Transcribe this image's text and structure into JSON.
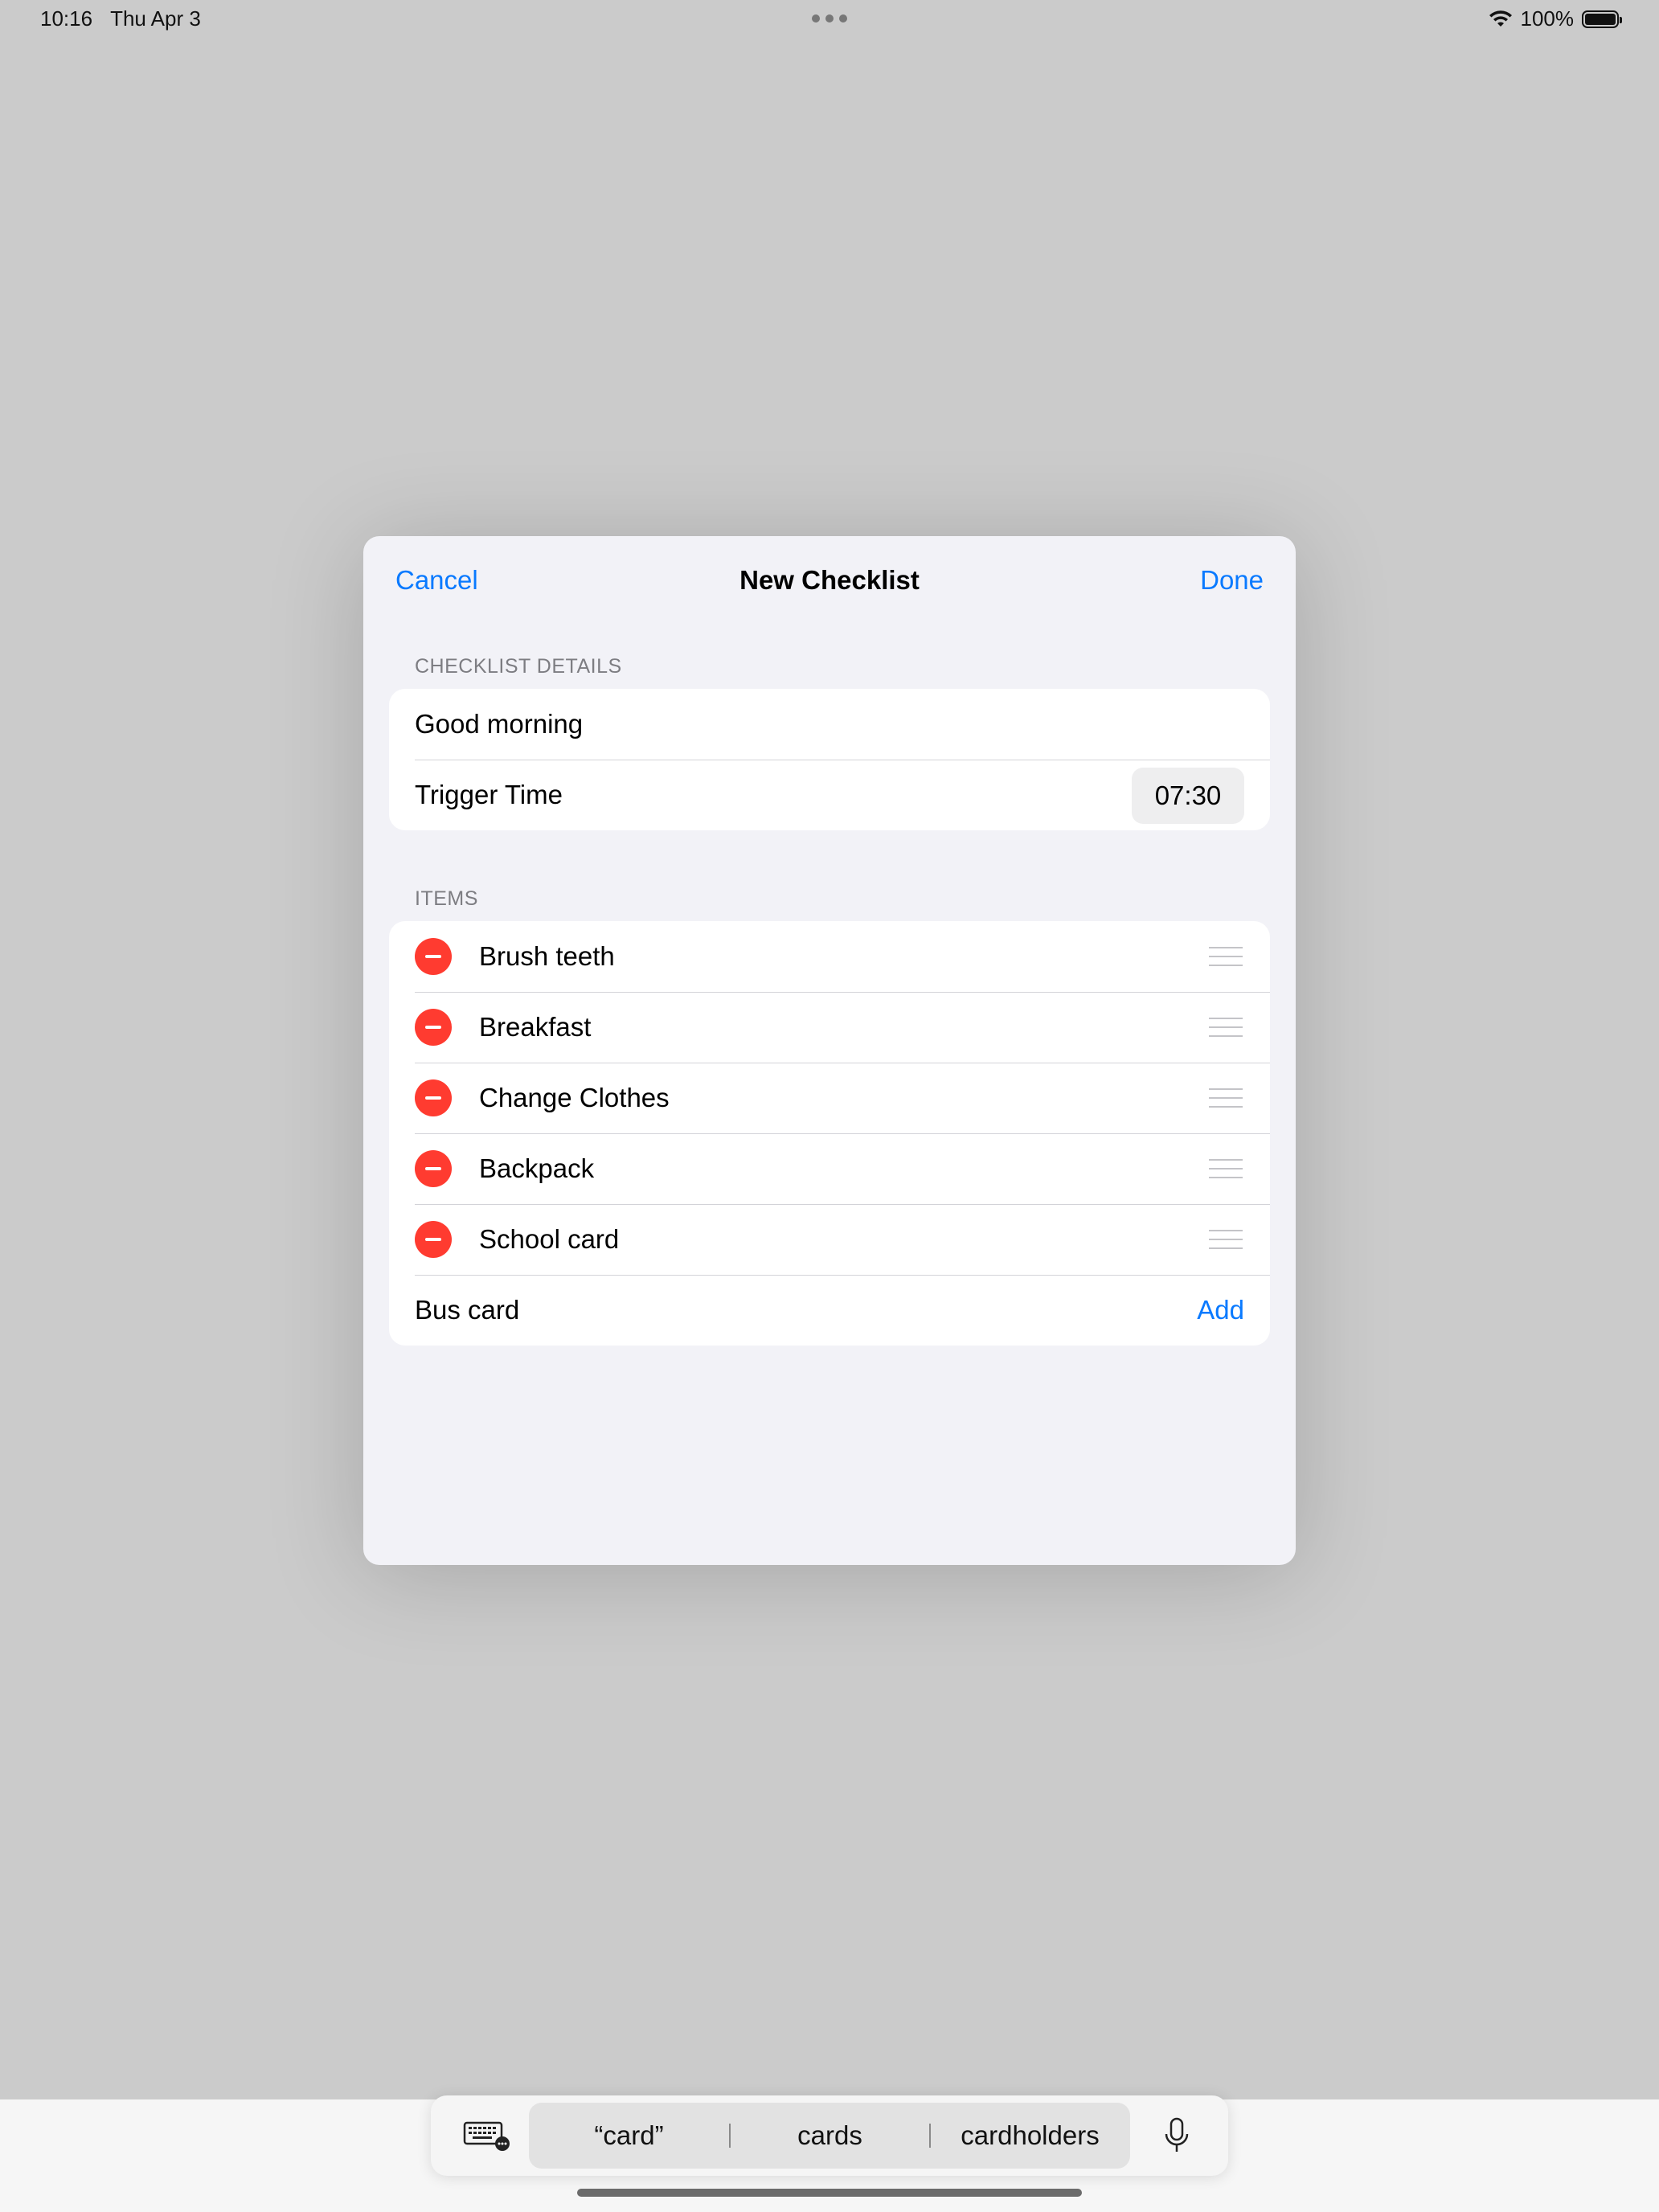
{
  "status_bar": {
    "time": "10:16",
    "date": "Thu Apr 3",
    "battery": "100%",
    "wifi_icon": "wifi-icon",
    "battery_icon": "battery-icon"
  },
  "nav": {
    "cancel": "Cancel",
    "title": "New Checklist",
    "done": "Done"
  },
  "details": {
    "header": "CHECKLIST DETAILS",
    "name_value": "Good morning",
    "trigger_label": "Trigger Time",
    "trigger_time": "07:30"
  },
  "items": {
    "header": "ITEMS",
    "list": [
      {
        "label": "Brush teeth"
      },
      {
        "label": "Breakfast"
      },
      {
        "label": "Change Clothes"
      },
      {
        "label": "Backpack"
      },
      {
        "label": "School card"
      }
    ],
    "new_item_value": "Bus card",
    "add_label": "Add"
  },
  "keyboard_bar": {
    "suggestions": [
      "“card”",
      "cards",
      "cardholders"
    ],
    "keyboard_icon": "keyboard-icon",
    "mic_icon": "microphone-icon"
  },
  "colors": {
    "accent": "#0a7aff",
    "delete": "#ff3b30",
    "background": "#cbcbcb",
    "sheet": "#f2f2f7"
  }
}
